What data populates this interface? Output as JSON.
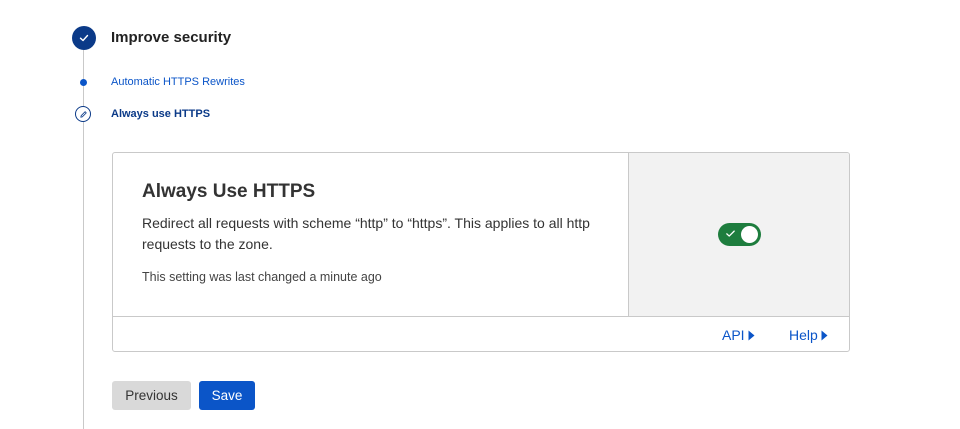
{
  "step": {
    "title": "Improve security",
    "substeps": [
      {
        "label": "Automatic HTTPS Rewrites"
      },
      {
        "label": "Always use HTTPS"
      }
    ]
  },
  "card": {
    "title": "Always Use HTTPS",
    "description": "Redirect all requests with scheme “http” to “https”. This applies to all http requests to the zone.",
    "meta": "This setting was last changed a minute ago",
    "toggle_on": true,
    "footer": {
      "api_label": "API",
      "help_label": "Help"
    }
  },
  "actions": {
    "previous_label": "Previous",
    "save_label": "Save"
  },
  "colors": {
    "step_complete": "#0b3a88",
    "link": "#0b55c8",
    "toggle_on": "#1e7d3e",
    "save_button": "#0b55c8",
    "previous_button": "#d9d9d9"
  },
  "icons": {
    "step": "check-icon",
    "current_substep": "pencil-icon",
    "toggle": "check-icon",
    "link_arrow": "caret-right-icon"
  }
}
